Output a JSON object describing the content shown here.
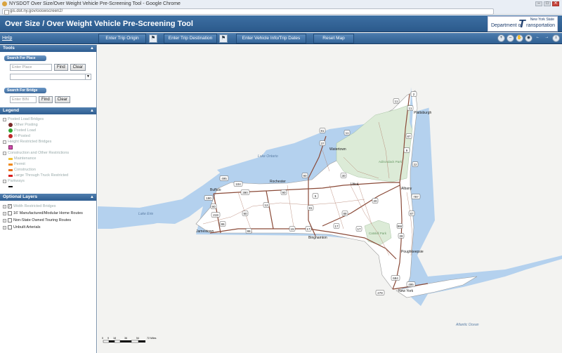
{
  "browser": {
    "tab_title": "NYSDOT Over Size/Over Weight Vehicle Pre-Screening Tool - Google Chrome",
    "url": "gis.dot.ny.gov/ooswscreen2/",
    "window_buttons": [
      "–",
      "□",
      "✕"
    ]
  },
  "banner": {
    "title": "Over Size / Over Weight Vehicle Pre-Screening Tool",
    "logo_state": "New York State",
    "logo_dept": "Department of",
    "logo_trans": "ransportation"
  },
  "toolbar": {
    "help": "Help",
    "trip_origin": "Enter Trip Origin",
    "trip_destination": "Enter Trip Destination",
    "vehicle_info": "Enter Vehicle Info/Trip Dates",
    "reset_map": "Reset Map",
    "flag_glyph": "⚑",
    "map_tools": [
      "zoom-in-icon",
      "zoom-out-icon",
      "pan-hand-icon",
      "full-extent-icon",
      "back-arrow-icon",
      "forward-arrow-icon",
      "info-icon"
    ]
  },
  "sidebar": {
    "tools_header": "Tools",
    "search_place": {
      "label": "Search For Place",
      "placeholder": "Enter Place",
      "find": "Find",
      "clear": "Clear",
      "dropdown_value": ""
    },
    "search_bridge": {
      "label": "Search For Bridge",
      "placeholder": "Enter BIN",
      "find": "Find",
      "clear": "Clear"
    },
    "legend_header": "Legend",
    "legend": {
      "posted_load": "Posted Load Bridges",
      "other_posting": "Other Posting",
      "posted_load_item": "Posted Load",
      "r_posted": "R-Posted",
      "height_restricted": "Height Restricted Bridges",
      "construction": "Construction and Other Restrictions",
      "maintenance": "Maintenance",
      "permit": "Permit",
      "construction_item": "Construction",
      "large_truck": "Large Through Truck Restricted",
      "parkways": "Parkways"
    },
    "optional_header": "Optional Layers",
    "optional_layers": [
      "Width Restricted Bridges",
      "16' Manufactured/Modular Home Routes",
      "Non-State Owned Touring Routes",
      "Unbuilt Arterials"
    ]
  },
  "map": {
    "labels": {
      "lake_ontario": "Lake Ontario",
      "lake_erie": "Lake Erie",
      "atlantic": "Atlantic Ocean",
      "adirondack": "Adirondack Park",
      "catskill": "Catskill Park",
      "buffalo": "Buffalo",
      "rochester": "Rochester",
      "watertown": "Watertown",
      "utica": "Utica",
      "albany": "Albany",
      "binghamton": "Binghamton",
      "jamestown": "Jamestown",
      "plattsburgh": "Plattsburgh",
      "poughkeepsie": "Poughkeepsie",
      "new_york": "New York"
    },
    "route_shields": [
      "2",
      "11",
      "11",
      "87",
      "22",
      "9",
      "11",
      "81",
      "37",
      "90",
      "495",
      "390",
      "190",
      "90",
      "86",
      "219",
      "15",
      "17",
      "88",
      "81",
      "87",
      "17",
      "684",
      "495",
      "278",
      "9W",
      "787",
      "28",
      "17",
      "86",
      "30",
      "104",
      "12",
      "90",
      "5",
      "20",
      "90"
    ],
    "scale_labels": [
      "0",
      "9",
      "18",
      "36",
      "54",
      "72 Miles"
    ]
  }
}
